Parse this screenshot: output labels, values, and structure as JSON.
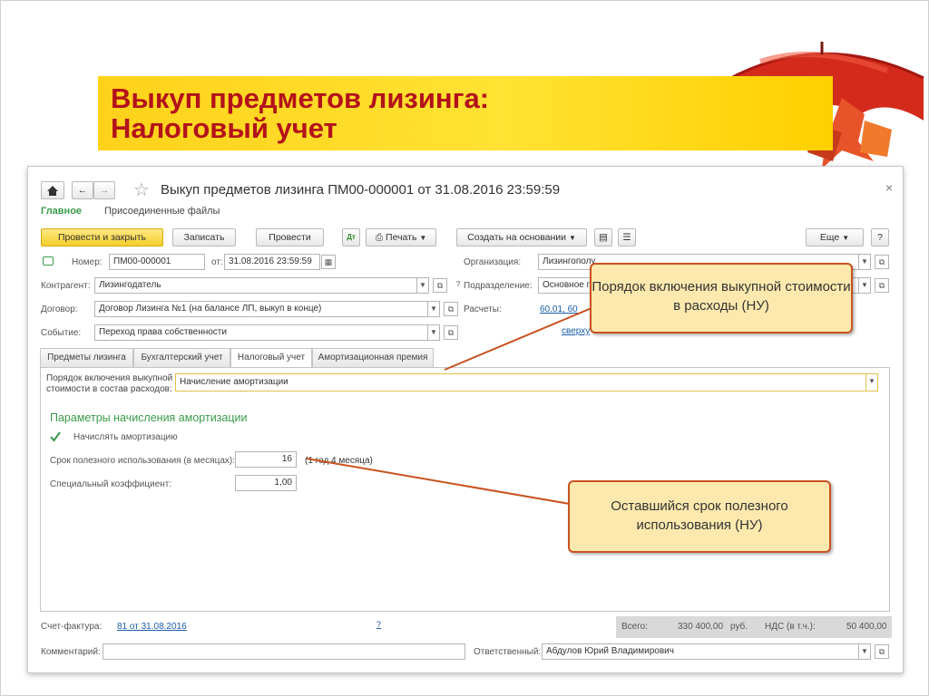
{
  "slide": {
    "title_line1": "Выкуп предметов лизинга:",
    "title_line2": "Налоговый учет"
  },
  "window": {
    "doc_title": "Выкуп предметов лизинга ПМ00-000001 от 31.08.2016 23:59:59",
    "close_glyph": "×",
    "nav": {
      "main": "Главное",
      "files": "Присоединенные файлы"
    },
    "toolbar": {
      "post_close": "Провести и закрыть",
      "save": "Записать",
      "post": "Провести",
      "print": "Печать",
      "create_based": "Создать на основании",
      "more": "Еще",
      "help": "?"
    },
    "header": {
      "number_label": "Номер:",
      "number_value": "ПМ00-000001",
      "date_label": "от:",
      "date_value": "31.08.2016 23:59:59",
      "contractor_label": "Контрагент:",
      "contractor_value": "Лизингодатель",
      "contract_label": "Договор:",
      "contract_value": "Договор Лизинга №1 (на балансе ЛП, выкуп в конце)",
      "event_label": "Событие:",
      "event_value": "Переход права собственности",
      "org_label": "Организация:",
      "org_value": "Лизингополу",
      "dept_label": "Подразделение:",
      "dept_value": "Основное п",
      "settlements_label": "Расчеты:",
      "settlements_value": "60.01, 60",
      "settlements_extra": "сверху"
    },
    "tabs": [
      "Предметы лизинга",
      "Бухгалтерский учет",
      "Налоговый учет",
      "Амортизационная премия"
    ],
    "tab_active": 2,
    "tax": {
      "order_label_1": "Порядок включения выкупной",
      "order_label_2": "стоимости в состав расходов:",
      "order_value": "Начисление амортизации",
      "section_title": "Параметры начисления амортизации",
      "accrue_label": "Начислять амортизацию",
      "accrue_checked": true,
      "term_label": "Срок полезного использования (в месяцах):",
      "term_value": "16",
      "term_note": "(1 год 4 месяца)",
      "coef_label": "Специальный коэффициент:",
      "coef_value": "1,00"
    },
    "footer": {
      "invoice_label": "Счет-фактура:",
      "invoice_value": "81 от 31.08.2016",
      "invoice_help": "?",
      "total_label": "Всего:",
      "total_value": "330 400,00",
      "currency": "руб.",
      "vat_label": "НДС (в т.ч.):",
      "vat_value": "50 400,00",
      "comment_label": "Комментарий:",
      "comment_value": "",
      "responsible_label": "Ответственный:",
      "responsible_value": "Абдулов Юрий Владимирович"
    }
  },
  "callouts": {
    "order": "Порядок включения выкупной стоимости в расходы (НУ)",
    "remaining": "Оставшийся срок полезного использования (НУ)"
  },
  "colors": {
    "title_text": "#b3121a",
    "title_bg": "#ffd21a",
    "callout_bg": "#fde9ae",
    "callout_border": "#c9511f",
    "primary_button": "#f5cf2a",
    "section_green": "#3a9a4a",
    "link": "#1a5ea8"
  }
}
